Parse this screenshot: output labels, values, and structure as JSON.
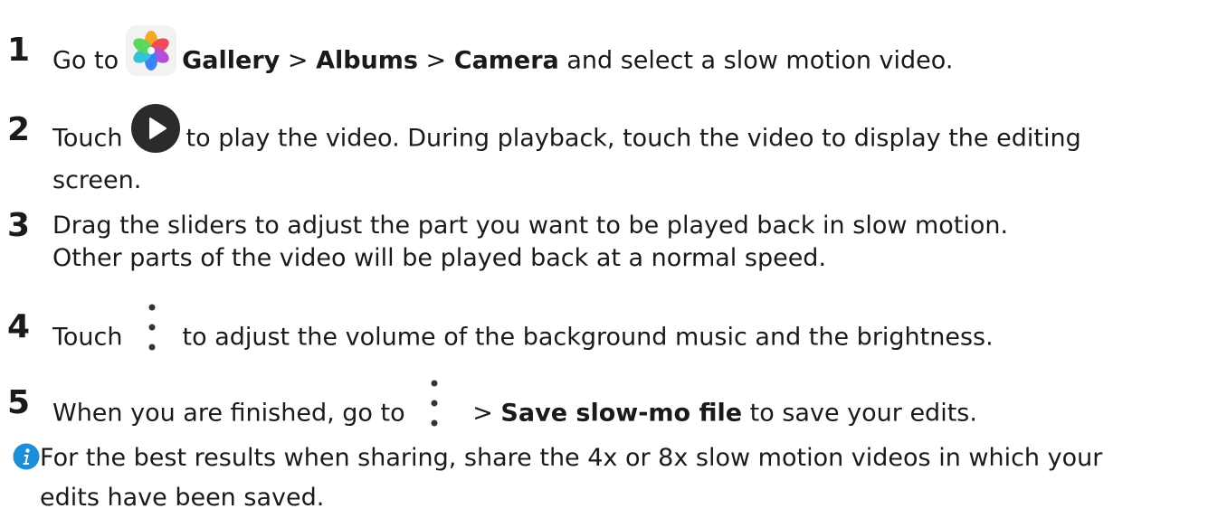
{
  "steps": [
    {
      "number": "1",
      "prefix": "Go to",
      "icon": "gallery-icon",
      "bold1": "Gallery",
      "sep1": " > ",
      "bold2": "Albums",
      "sep2": " > ",
      "bold3": "Camera",
      "suffix": " and select a slow motion video."
    },
    {
      "number": "2",
      "prefix": "Touch",
      "icon": "play-icon",
      "suffix": "to play the video. During playback, touch the video to display the editing",
      "line2": "screen."
    },
    {
      "number": "3",
      "line1": "Drag the sliders to adjust the part you want to be played back in slow motion.",
      "line2": "Other parts of the video will be played back at a normal speed."
    },
    {
      "number": "4",
      "prefix": "Touch",
      "icon": "more-vertical-icon",
      "suffix": "to adjust the volume of the background music and the brightness."
    },
    {
      "number": "5",
      "prefix": "When you are finished, go to",
      "icon": "more-vertical-icon",
      "sep": " > ",
      "bold": "Save slow-mo file",
      "suffix": " to save your edits."
    }
  ],
  "note": {
    "icon": "info-icon",
    "line1": "For the best results when sharing, share the 4x or 8x slow motion videos in which your",
    "line2": "edits have been saved."
  },
  "colors": {
    "text": "#1a1a1a",
    "play_icon": "#2b2b2b",
    "info_icon": "#1e8fd6",
    "more_dots": "#333333"
  }
}
